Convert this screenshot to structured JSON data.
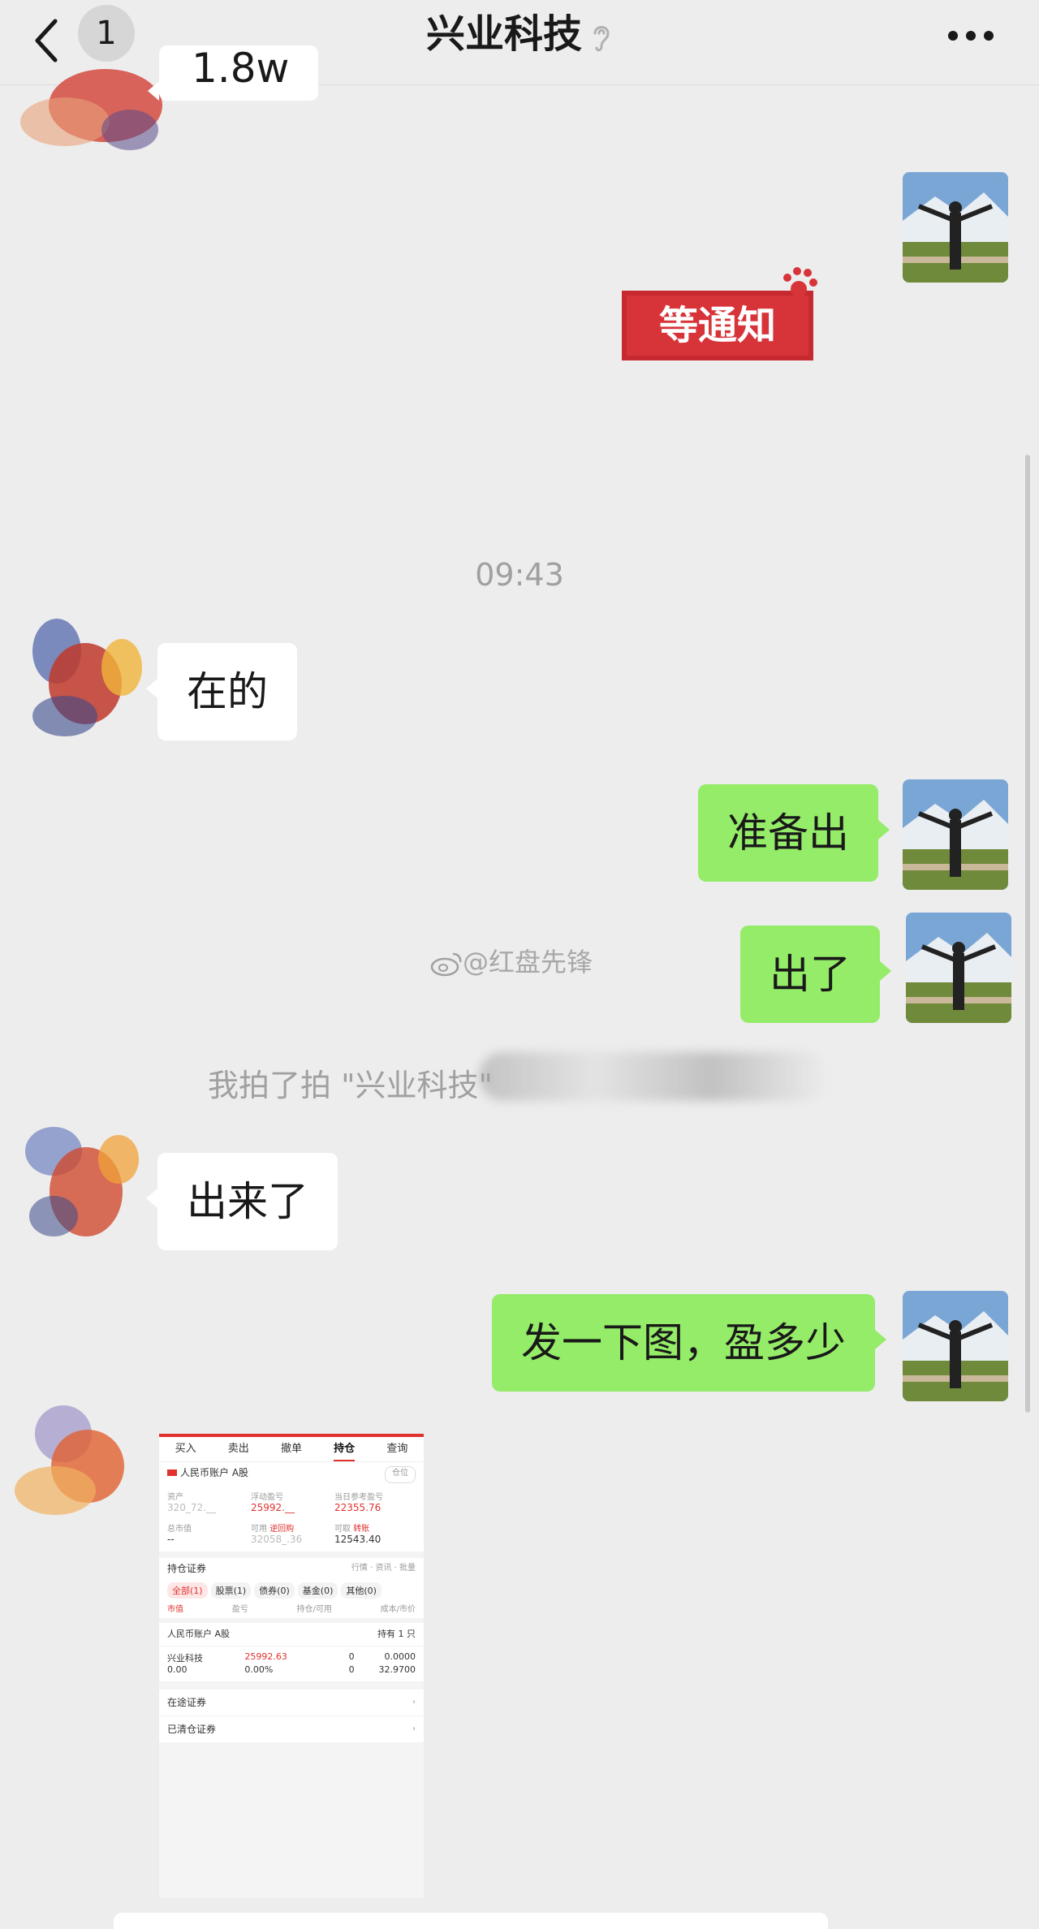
{
  "header": {
    "back_badge": "1",
    "title": "兴业科技"
  },
  "partial_message": "1.8w",
  "stamp_text": "等通知",
  "time_divider": "09:43",
  "messages": [
    {
      "side": "in",
      "text": "在的"
    },
    {
      "side": "out",
      "text": "准备出"
    },
    {
      "side": "out",
      "text": "出了"
    },
    {
      "side": "in",
      "text": "出来了"
    },
    {
      "side": "out",
      "text": "发一下图，盈多少"
    }
  ],
  "system_notice": "我拍了拍 \"兴业科技\"",
  "watermark": "@红盘先锋",
  "shared_screenshot": {
    "tabs": [
      "买入",
      "卖出",
      "撤单",
      "持仓",
      "查询"
    ],
    "active_tab": "持仓",
    "account": "人民币账户 A股",
    "account_btn": "仓位",
    "labels": {
      "assets": "资产",
      "float_pnl": "浮动盈亏",
      "day_pnl": "当日参考盈亏",
      "market_value": "总市值",
      "available": "可用",
      "withdrawable": "可取",
      "reverse_repo": "逆回购",
      "transfer": "转账"
    },
    "values": {
      "assets": "320_72.__",
      "float_pnl": "25992.__",
      "day_pnl": "22355.76",
      "market_value": "--",
      "available": "32058_.36",
      "withdrawable": "12543.40"
    },
    "holdings_title": "持仓证券",
    "holdings_actions": [
      "行情",
      "资讯",
      "批量"
    ],
    "filters": [
      "全部(1)",
      "股票(1)",
      "债券(0)",
      "基金(0)",
      "其他(0)"
    ],
    "columns": [
      "市值",
      "盈亏",
      "持仓/可用",
      "成本/市价"
    ],
    "group": "人民币账户 A股",
    "group_count": "持有 1 只",
    "stock": {
      "name": "兴业科技",
      "pnl": "25992.63",
      "position": "0",
      "cost": "0.0000",
      "value": "0.00",
      "pnl_pct": "0.00%",
      "available": "0",
      "price": "32.9700"
    },
    "links": [
      "在途证券",
      "已清仓证券"
    ]
  }
}
